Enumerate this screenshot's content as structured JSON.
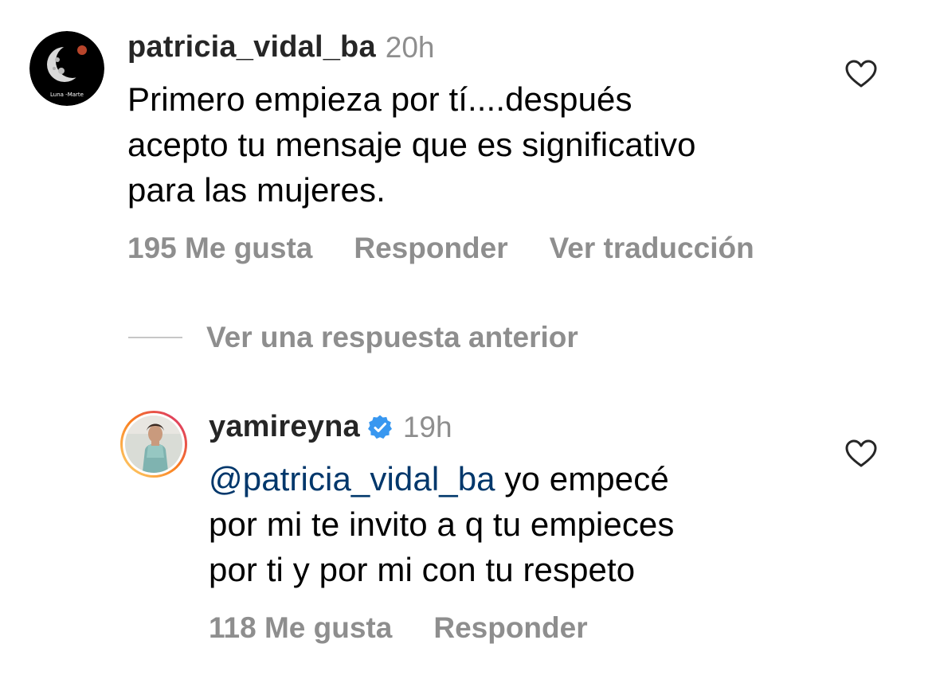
{
  "comments": [
    {
      "username": "patricia_vidal_ba",
      "time": "20h",
      "avatar_caption": "Luna -Marte",
      "text": "Primero empieza por tí....después acepto tu mensaje que es significativo para las mujeres.",
      "text_lines": [
        "Primero empieza por tí....después",
        "acepto tu mensaje que es significativo",
        "para las mujeres."
      ],
      "likes_label": "195 Me gusta",
      "reply_label": "Responder",
      "translate_label": "Ver traducción",
      "like_icon": "heart-outline-icon"
    }
  ],
  "replies_toggle": {
    "label": "Ver una respuesta anterior"
  },
  "reply": {
    "username": "yamireyna",
    "verified": true,
    "time": "19h",
    "mention": "@patricia_vidal_ba",
    "text_line_1_rest": " yo empecé",
    "text_lines_rest": [
      "por mi te invito a q tu empieces",
      "por ti y por mi con tu respeto"
    ],
    "likes_label": "118 Me gusta",
    "reply_label": "Responder",
    "like_icon": "heart-outline-icon"
  },
  "colors": {
    "username": "#262626",
    "secondary": "#8e8e8e",
    "mention": "#00376b",
    "verified_badge": "#3897f0",
    "story_ring_start": "#feda75",
    "story_ring_end": "#d62976"
  }
}
